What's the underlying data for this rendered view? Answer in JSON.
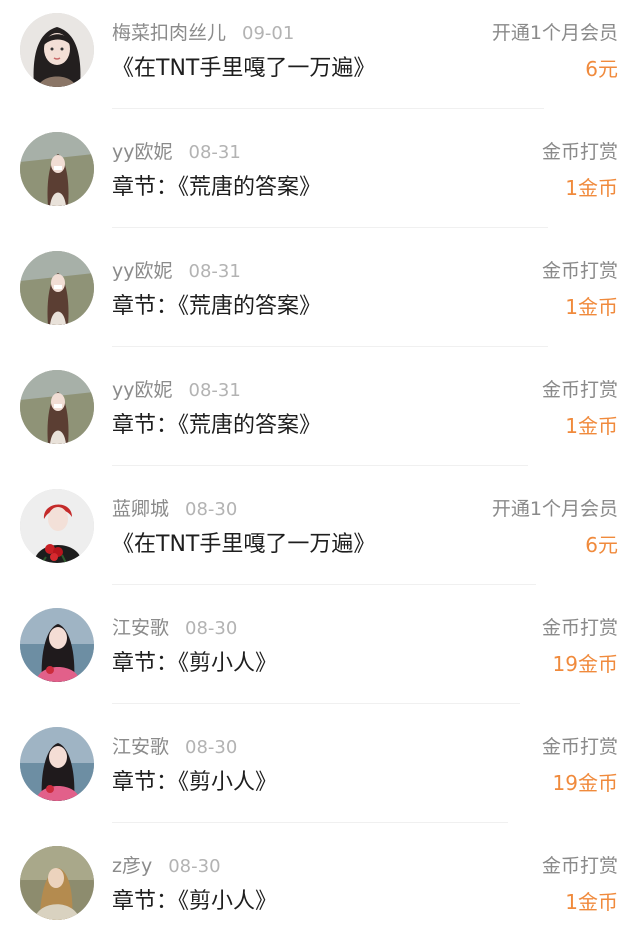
{
  "records": [
    {
      "name": "梅菜扣肉丝儿",
      "date": "09-01",
      "action": "开通1个月会员",
      "title": "《在TNT手里嘎了一万遍》",
      "amount": "6元",
      "avatar_icon": "avatar-girl-long-dark-hair-icon"
    },
    {
      "name": "yy欧妮",
      "date": "08-31",
      "action": "金币打赏",
      "title": "章节：《荒唐的答案》",
      "amount": "1金币",
      "avatar_icon": "avatar-girl-outdoor-icon"
    },
    {
      "name": "yy欧妮",
      "date": "08-31",
      "action": "金币打赏",
      "title": "章节：《荒唐的答案》",
      "amount": "1金币",
      "avatar_icon": "avatar-girl-outdoor-icon"
    },
    {
      "name": "yy欧妮",
      "date": "08-31",
      "action": "金币打赏",
      "title": "章节：《荒唐的答案》",
      "amount": "1金币",
      "avatar_icon": "avatar-girl-outdoor-icon"
    },
    {
      "name": "蓝卿城",
      "date": "08-30",
      "action": "开通1个月会员",
      "title": "《在TNT手里嘎了一万遍》",
      "amount": "6元",
      "avatar_icon": "avatar-man-red-hair-roses-icon"
    },
    {
      "name": "江安歌",
      "date": "08-30",
      "action": "金币打赏",
      "title": "章节：《剪小人》",
      "amount": "19金币",
      "avatar_icon": "avatar-girl-pink-sweater-icon"
    },
    {
      "name": "江安歌",
      "date": "08-30",
      "action": "金币打赏",
      "title": "章节：《剪小人》",
      "amount": "19金币",
      "avatar_icon": "avatar-girl-pink-sweater-icon"
    },
    {
      "name": "z彦y",
      "date": "08-30",
      "action": "金币打赏",
      "title": "章节：《剪小人》",
      "amount": "1金币",
      "avatar_icon": "avatar-girl-painting-icon"
    }
  ],
  "colors": {
    "amount": "#f08a3c",
    "name": "#8b8b8b",
    "date": "#b3b3b3",
    "title": "#1e1e1e",
    "action": "#8a8a8a",
    "divider": "#f0f0f0"
  }
}
